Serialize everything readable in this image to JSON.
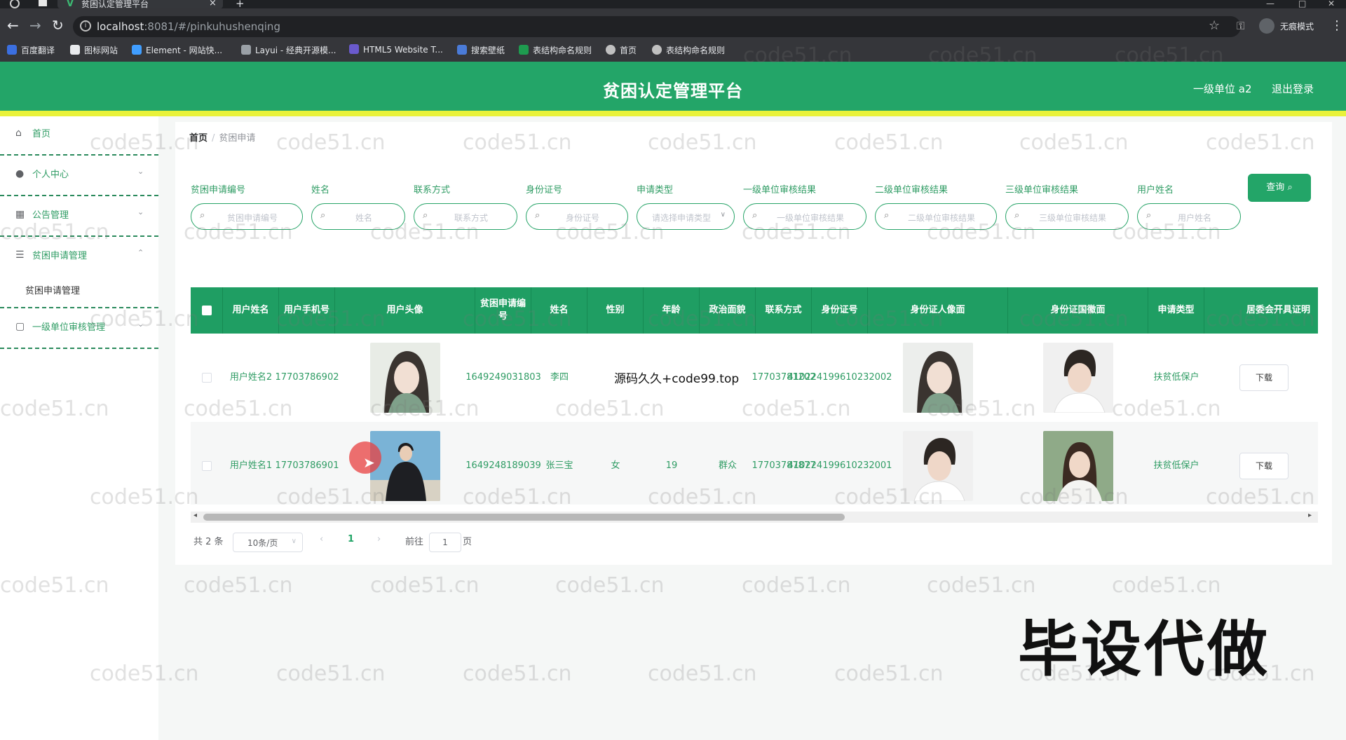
{
  "browser": {
    "tab_title": "贫困认定管理平台",
    "tab_close": "×",
    "new_tab": "+",
    "url_host": "localhost",
    "url_path": ":8081/#/pinkuhushenqing",
    "incognito_label": "无痕模式",
    "bookmarks": [
      {
        "label": "百度翻译",
        "color": "#3b6fe0"
      },
      {
        "label": "图标网站",
        "color": "#e8eaed"
      },
      {
        "label": "Element - 网站快...",
        "color": "#409eff"
      },
      {
        "label": "Layui - 经典开源模...",
        "color": "#9aa0a6"
      },
      {
        "label": "HTML5 Website T...",
        "color": "#6a5acd"
      },
      {
        "label": "搜索壁纸",
        "color": "#4a7bd8"
      },
      {
        "label": "表结构命名规则",
        "color": "#1e9b4f"
      },
      {
        "label": "首页",
        "color": "#c0c0c0"
      },
      {
        "label": "表结构命名规则",
        "color": "#c0c0c0"
      }
    ]
  },
  "header": {
    "title": "贫困认定管理平台",
    "user": "一级单位 a2",
    "logout": "退出登录"
  },
  "sidebar": {
    "items": [
      {
        "label": "首页",
        "icon": "home-icon"
      },
      {
        "label": "个人中心",
        "icon": "user-icon"
      },
      {
        "label": "公告管理",
        "icon": "grid-icon"
      },
      {
        "label": "贫困申请管理",
        "icon": "sliders-icon"
      },
      {
        "label": "一级单位审核管理",
        "icon": "document-icon"
      }
    ],
    "sub_item": "贫困申请管理"
  },
  "breadcrumb": {
    "home": "首页",
    "separator": "/",
    "current": "贫困申请"
  },
  "filters": [
    {
      "label": "贫困申请编号",
      "placeholder": "贫困申请编号"
    },
    {
      "label": "姓名",
      "placeholder": "姓名"
    },
    {
      "label": "联系方式",
      "placeholder": "联系方式"
    },
    {
      "label": "身份证号",
      "placeholder": "身份证号"
    },
    {
      "label": "申请类型",
      "placeholder": "请选择申请类型"
    },
    {
      "label": "一级单位审核结果",
      "placeholder": "一级单位审核结果"
    },
    {
      "label": "二级单位审核结果",
      "placeholder": "二级单位审核结果"
    },
    {
      "label": "三级单位审核结果",
      "placeholder": "三级单位审核结果"
    },
    {
      "label": "用户姓名",
      "placeholder": "用户姓名"
    }
  ],
  "query_button": "查询",
  "table": {
    "columns": [
      "用户姓名",
      "用户手机号",
      "用户头像",
      "贫困申请编号",
      "姓名",
      "性别",
      "年龄",
      "政治面貌",
      "联系方式",
      "身份证号",
      "身份证人像面",
      "身份证国徽面",
      "申请类型",
      "居委会开具证明"
    ],
    "rows": [
      {
        "user_name": "用户姓名2",
        "user_phone": "17703786902",
        "avatar": "avatar-photo",
        "apply_no": "1649249031803",
        "name": "李四",
        "gender": "",
        "age": "",
        "politics": "",
        "contact": "17703781202",
        "id_no": "410224199610232002",
        "id_front": "id-front-photo",
        "id_back": "id-back-photo",
        "apply_type": "扶贫低保户",
        "action": "下载"
      },
      {
        "user_name": "用户姓名1",
        "user_phone": "17703786901",
        "avatar": "avatar-photo",
        "apply_no": "1649248189039",
        "name": "张三宝",
        "gender": "女",
        "age": "19",
        "politics": "群众",
        "contact": "17703787877",
        "id_no": "410224199610232001",
        "id_front": "id-front-photo",
        "id_back": "id-back-photo",
        "apply_type": "扶贫低保户",
        "action": "下载"
      }
    ]
  },
  "pagination": {
    "total": "共 2 条",
    "page_size": "10条/页",
    "prev": "‹",
    "current_page": "1",
    "next": "›",
    "goto_label": "前往",
    "goto_value": "1",
    "page_suffix": "页"
  },
  "overlay": {
    "watermark": "code51.cn",
    "center_text": "源码久久+code99.top",
    "big_text": "毕设代做"
  },
  "colors": {
    "primary": "#23a568",
    "accent_bar": "#e9f23a",
    "text_green": "#2f9c64"
  }
}
